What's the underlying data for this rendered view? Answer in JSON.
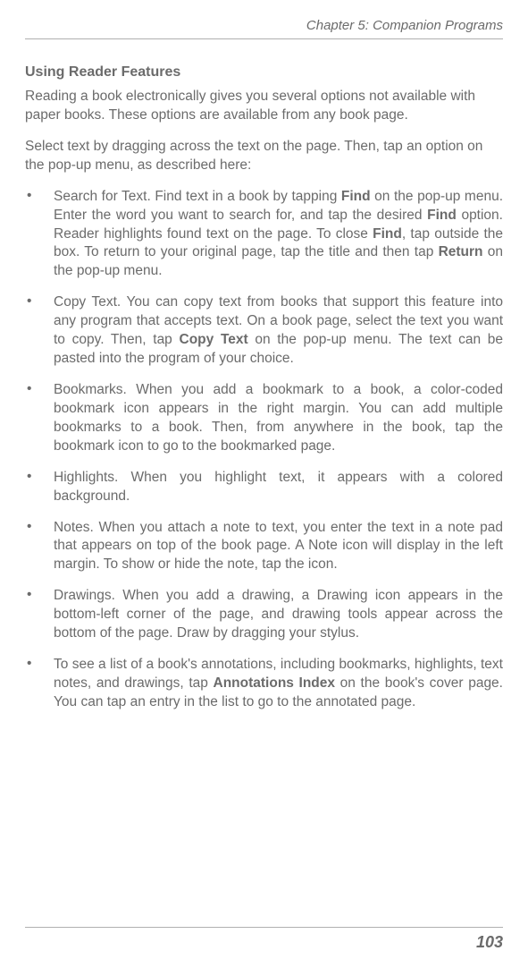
{
  "header": {
    "chapter_line": "Chapter 5: Companion Programs"
  },
  "section": {
    "title": "Using Reader Features",
    "intro1": "Reading a book electronically gives you several options not available with paper books. These options are available from any book page.",
    "intro2": "Select text by dragging across the text on the page. Then, tap an option on the pop-up menu, as described here:"
  },
  "bullets": [
    {
      "pre": "Search for Text. Find text in a book by tapping ",
      "b1": "Find",
      "mid1": " on the pop-up menu. Enter the word you want to search for, and tap the desired ",
      "b2": "Find",
      "mid2": " option. Reader highlights found text on the page. To close ",
      "b3": "Find",
      "mid3": ", tap outside the box. To return to your original page, tap the title and then tap ",
      "b4": "Return",
      "post": " on the pop-up menu."
    },
    {
      "pre": "Copy Text. You can copy text from books that support this feature into any program that accepts text. On a book page, select the text you want to copy. Then, tap ",
      "b1": "Copy Text",
      "post": " on the pop-up menu. The text can be pasted into the program of your choice."
    },
    {
      "text": "Bookmarks. When you add a bookmark to a book, a color-coded bookmark icon appears in the right margin. You can add multiple bookmarks to a book. Then, from anywhere in the book, tap the bookmark icon to go to the bookmarked page."
    },
    {
      "text": "Highlights. When you highlight text, it appears with a colored background."
    },
    {
      "text": "Notes. When you attach a note to text, you enter the text in a note pad that appears on top of the book page. A Note icon will display in the left margin. To show or hide the note, tap the icon."
    },
    {
      "text": "Drawings. When you add a drawing, a Drawing icon appears in the bottom-left corner of the page, and drawing tools appear across the bottom of the page. Draw by dragging your stylus."
    },
    {
      "pre": "To see a list of a book's annotations, including bookmarks, highlights, text notes, and drawings, tap ",
      "b1": "Annotations Index",
      "post": " on the book's cover page. You can tap an entry in the list to go to the annotated page."
    }
  ],
  "footer": {
    "page_number": "103"
  },
  "bullet_marker": "•"
}
